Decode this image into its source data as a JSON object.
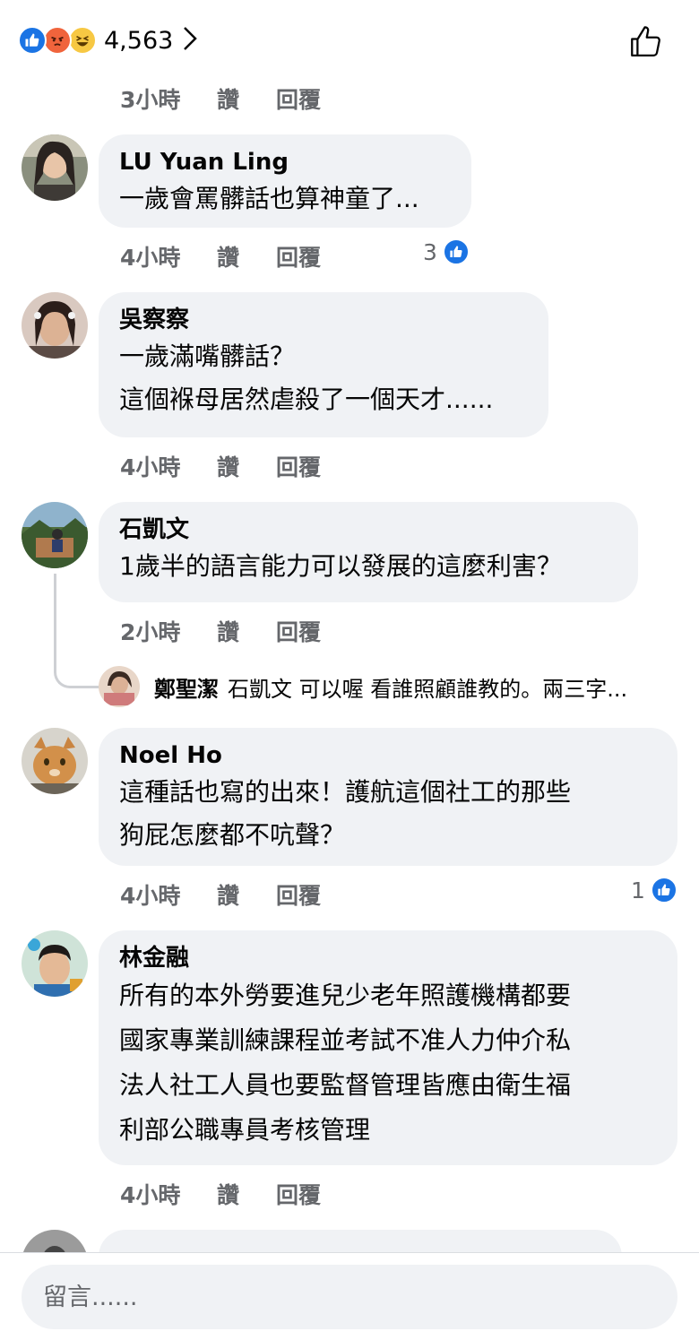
{
  "reactions": {
    "count": "4,563",
    "icons": [
      "like-icon",
      "angry-icon",
      "haha-icon"
    ]
  },
  "header_actions": {
    "like_icon": "thumbs-up-icon"
  },
  "top_comment_meta": {
    "time": "3小時",
    "like": "讚",
    "reply": "回覆"
  },
  "comments": [
    {
      "author": "LU Yuan Ling",
      "text": "一歲會罵髒話也算神童了...",
      "time": "4小時",
      "like": "讚",
      "reply": "回覆",
      "reaction_count": "3"
    },
    {
      "author": "吳察察",
      "text": "一歲滿嘴髒話？\n這個褓母居然虐殺了一個天才......",
      "time": "4小時",
      "like": "讚",
      "reply": "回覆"
    },
    {
      "author": "石凱文",
      "text": "1歲半的語言能力可以發展的這麼利害？",
      "time": "2小時",
      "like": "讚",
      "reply": "回覆",
      "reply_preview": {
        "author": "鄭聖潔",
        "text": "石凱文 可以喔 看誰照顧誰教的。兩三字..."
      }
    },
    {
      "author": "Noel Ho",
      "text": "這種話也寫的出來！護航這個社工的那些\n狗屁怎麼都不吭聲？",
      "time": "4小時",
      "like": "讚",
      "reply": "回覆",
      "reaction_count": "1"
    },
    {
      "author": "林金融",
      "text": "所有的本外勞要進兒少老年照護機構都要\n國家專業訓練課程並考試不准人力仲介私\n法人社工人員也要監督管理皆應由衛生福\n利部公職專員考核管理",
      "time": "4小時",
      "like": "讚",
      "reply": "回覆"
    }
  ],
  "composer": {
    "placeholder": "留言......"
  },
  "colors": {
    "like_blue": "#1b74e4",
    "bubble_bg": "#f0f2f5",
    "meta_gray": "#65676b"
  }
}
